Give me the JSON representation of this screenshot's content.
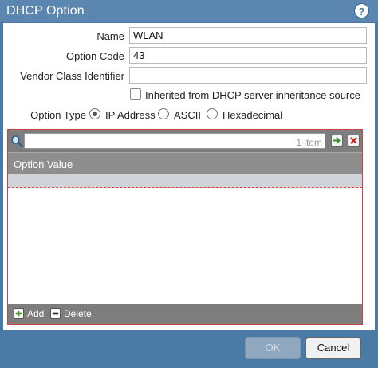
{
  "window": {
    "title": "DHCP Option",
    "help_glyph": "?"
  },
  "form": {
    "name_label": "Name",
    "name_value": "WLAN",
    "option_code_label": "Option Code",
    "option_code_value": "43",
    "vendor_label": "Vendor Class Identifier",
    "vendor_value": "",
    "inherited_label": "Inherited from DHCP server inheritance source",
    "inherited_checked": false,
    "option_type_label": "Option Type",
    "option_types": [
      {
        "label": "IP Address",
        "selected": true
      },
      {
        "label": "ASCII",
        "selected": false
      },
      {
        "label": "Hexadecimal",
        "selected": false
      }
    ]
  },
  "grid": {
    "search_value": "",
    "count_text": "1 item",
    "column_header": "Option Value",
    "add_label": "Add",
    "delete_label": "Delete"
  },
  "buttons": {
    "ok_label": "OK",
    "cancel_label": "Cancel"
  },
  "colors": {
    "accent": "#4a7aa6",
    "error_border": "#cc4444"
  },
  "icons": {
    "help": "help-icon",
    "search": "search-icon",
    "go": "arrow-right-icon",
    "clear": "close-icon",
    "add": "plus-icon",
    "delete": "minus-icon"
  }
}
